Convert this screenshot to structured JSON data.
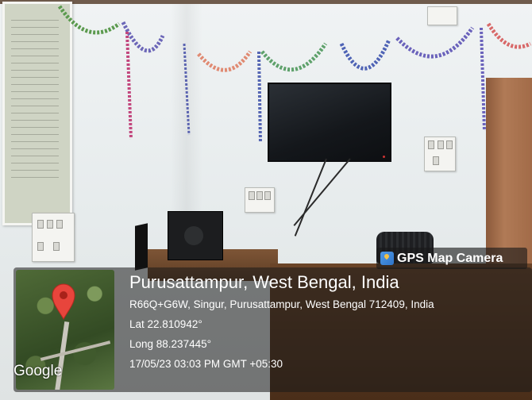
{
  "overlay": {
    "app_name": "GPS Map Camera",
    "location_title": "Purusattampur, West Bengal, India",
    "address": "R66Q+G6W, Singur, Purusattampur, West Bengal 712409, India",
    "latitude": "Lat 22.810942°",
    "longitude": "Long 88.237445°",
    "datetime": "17/05/23 03:03 PM GMT +05:30",
    "map_attribution": "Google"
  },
  "icons": {
    "brand": "gps-map-camera-icon",
    "pin": "map-pin-icon"
  },
  "colors": {
    "pin": "#e8453c",
    "overlay_text": "#ffffff",
    "brand_icon": "#3a82d6"
  }
}
